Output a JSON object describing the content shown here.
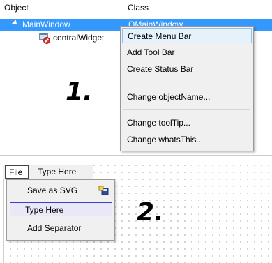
{
  "inspector": {
    "columns": {
      "object": "Object",
      "class": "Class"
    },
    "rows": [
      {
        "object": "MainWindow",
        "class": "QMainWindow",
        "selected": true
      },
      {
        "object": "centralWidget",
        "class": ""
      }
    ]
  },
  "context_menu": {
    "items": [
      {
        "label": "Create Menu Bar",
        "highlighted": true
      },
      {
        "label": "Add Tool Bar"
      },
      {
        "label": "Create Status Bar"
      },
      {
        "label": "Change objectName..."
      },
      {
        "label": "Change toolTip..."
      },
      {
        "label": "Change whatsThis..."
      }
    ]
  },
  "annotations": {
    "step1": "1.",
    "step2": "2."
  },
  "form": {
    "menubar": {
      "file": "File",
      "type_here": "Type Here"
    },
    "dropdown": {
      "items": [
        {
          "label": "Save as SVG",
          "icon": "save-svg-icon"
        },
        {
          "label": "Type Here",
          "active": true
        },
        {
          "label": "Add Separator"
        }
      ]
    }
  },
  "colors": {
    "selection": "#3399ff",
    "menu_highlight": "#e5f1fb",
    "menu_highlight_border": "#8fc2ec",
    "active_item_border": "#3c3ccf",
    "menu_bg": "#f0f0f0"
  }
}
